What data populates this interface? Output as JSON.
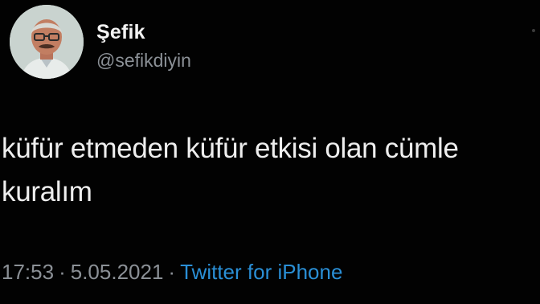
{
  "tweet": {
    "display_name": "Şefik",
    "handle": "@sefikdiyin",
    "text": "küfür etmeden küfür etkisi olan cümle\nkuralım",
    "time": "17:53",
    "separator": "·",
    "date": "5.05.2021",
    "source": "Twitter for iPhone"
  },
  "colors": {
    "background": "#020202",
    "text": "#eeeeee",
    "secondary": "#8b9096",
    "link": "#2a8fd6"
  },
  "icons": {
    "avatar": "profile-avatar",
    "more": "more-dot-icon"
  }
}
